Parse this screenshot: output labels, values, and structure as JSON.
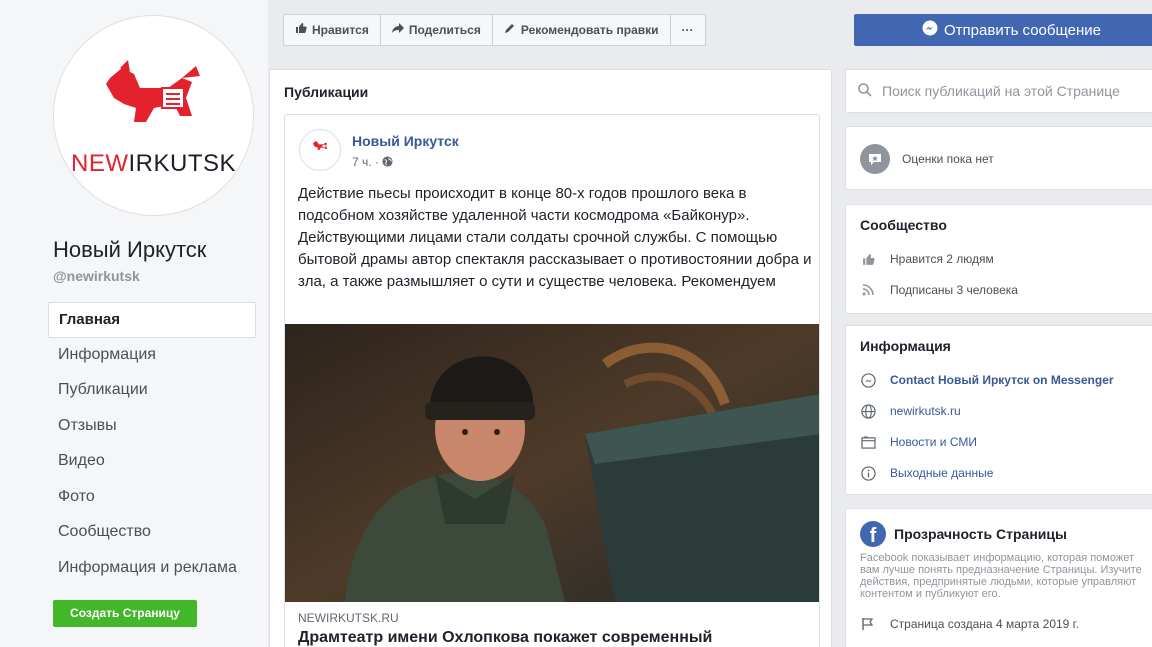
{
  "page": {
    "logo_text_red": "NEW",
    "logo_text_dark": "IRKUTSK",
    "name": "Новый Иркутск",
    "handle": "@newirkutsk"
  },
  "nav": {
    "items": [
      {
        "label": "Главная"
      },
      {
        "label": "Информация"
      },
      {
        "label": "Публикации"
      },
      {
        "label": "Отзывы"
      },
      {
        "label": "Видео"
      },
      {
        "label": "Фото"
      },
      {
        "label": "Сообщество"
      },
      {
        "label": "Информация и реклама"
      }
    ],
    "active": "Главная",
    "create_page": "Создать Страницу"
  },
  "actions": {
    "like": "Нравится",
    "share": "Поделиться",
    "suggest": "Рекомендовать правки",
    "more": "···",
    "send_message": "Отправить сообщение"
  },
  "posts": {
    "section_title": "Публикации",
    "post": {
      "author": "Новый Иркутск",
      "time": "7 ч. ·",
      "text": "Действие пьесы происходит в конце 80-х годов прошлого века в подсобном хозяйстве удаленной части космодрома «Байконур». Действующими лицами стали солдаты срочной службы. С помощью бытовой драмы автор спектакля рассказывает о противостоянии добра и зла, а также размышляет о сути и существе человека. Рекомендуем",
      "link_domain": "NEWIRKUTSK.RU",
      "link_title": "Драмтеатр имени Охлопкова покажет современный"
    }
  },
  "search": {
    "placeholder": "Поиск публикаций на этой Странице"
  },
  "reviews": {
    "text": "Оценки пока нет"
  },
  "community": {
    "title": "Сообщество",
    "likes": "Нравится 2 людям",
    "follows": "Подписаны 3 человека"
  },
  "info": {
    "title": "Информация",
    "messenger": "Contact Новый Иркутск on Messenger",
    "website": "newirkutsk.ru",
    "category": "Новости и СМИ",
    "hours": "Выходные данные"
  },
  "transparency": {
    "title": "Прозрачность Страницы",
    "description": "Facebook показывает информацию, которая поможет вам лучше понять предназначение Страницы. Изучите действия, предпринятые людьми, которые управляют контентом и публикуют его.",
    "created": "Страница создана 4 марта 2019 г."
  },
  "colors": {
    "brand_red": "#e3222d",
    "fb_blue": "#4267b2",
    "link_blue": "#385898",
    "green": "#42b72a"
  }
}
